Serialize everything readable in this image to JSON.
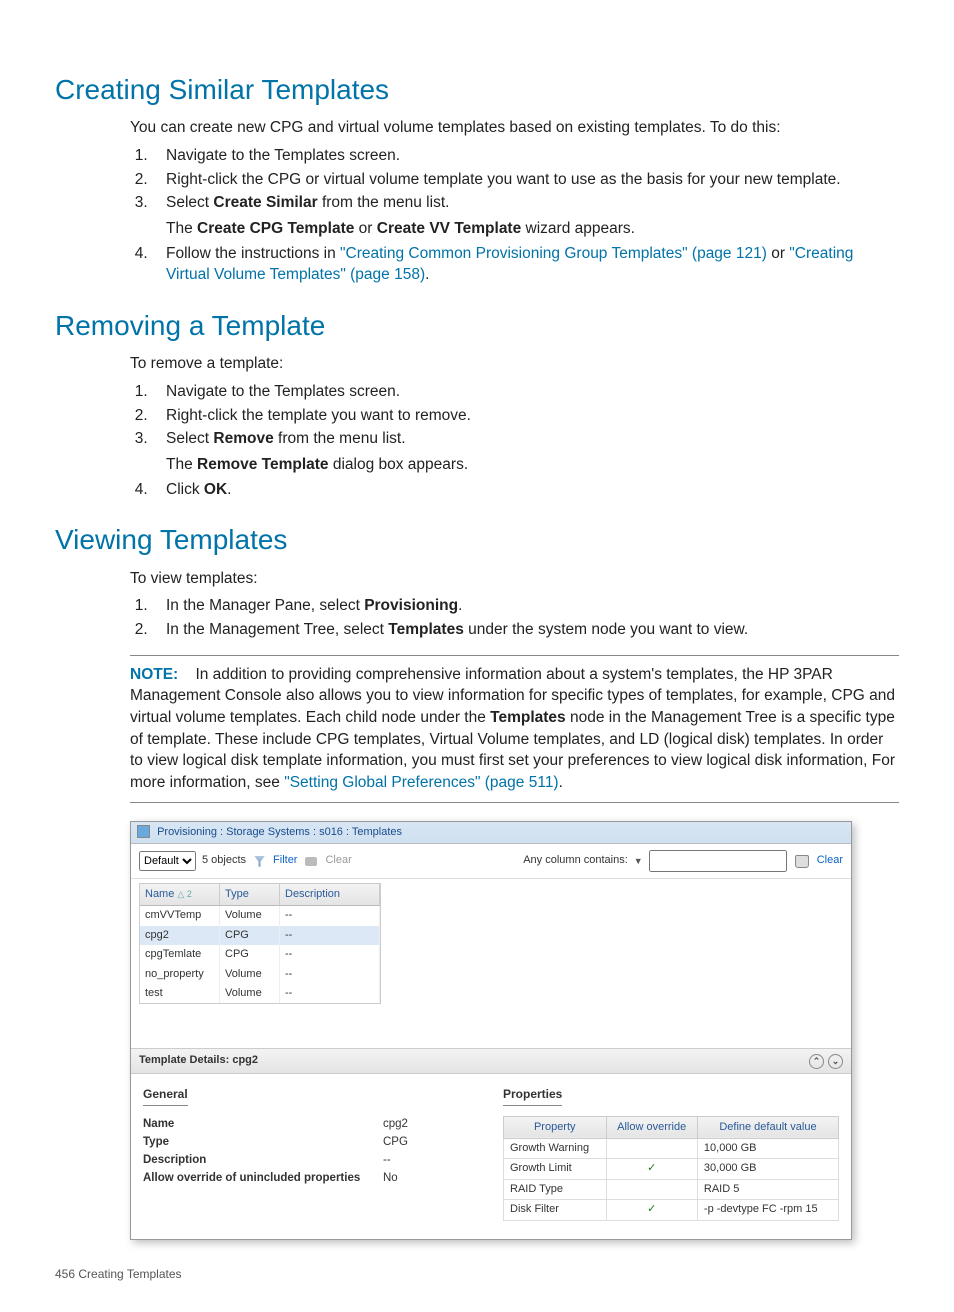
{
  "h1": "Creating Similar Templates",
  "p1": "You can create new CPG and virtual volume templates based on existing templates. To do this:",
  "l1_1": "Navigate to the Templates screen.",
  "l1_2": "Right-click the CPG or virtual volume template you want to use as the basis for your new template.",
  "l1_3a": "Select ",
  "l1_3b": "Create Similar",
  "l1_3c": " from the menu list.",
  "l1_3s1a": "The ",
  "l1_3s1b": "Create CPG Template",
  "l1_3s1c": " or ",
  "l1_3s1d": "Create VV Template",
  "l1_3s1e": " wizard appears.",
  "l1_4a": "Follow the instructions in ",
  "l1_4b": "\"Creating Common Provisioning Group Templates\" (page 121)",
  "l1_4c": " or ",
  "l1_4d": "\"Creating Virtual Volume Templates\" (page 158)",
  "l1_4e": ".",
  "h2": "Removing a Template",
  "p2": "To remove a template:",
  "l2_1": "Navigate to the Templates screen.",
  "l2_2": "Right-click the template you want to remove.",
  "l2_3a": "Select ",
  "l2_3b": "Remove",
  "l2_3c": " from the menu list.",
  "l2_3s1a": "The ",
  "l2_3s1b": "Remove Template",
  "l2_3s1c": " dialog box appears.",
  "l2_4a": "Click ",
  "l2_4b": "OK",
  "l2_4c": ".",
  "h3": "Viewing Templates",
  "p3": "To view templates:",
  "l3_1a": "In the Manager Pane, select ",
  "l3_1b": "Provisioning",
  "l3_1c": ".",
  "l3_2a": "In the Management Tree, select ",
  "l3_2b": "Templates",
  "l3_2c": " under the system node you want to view.",
  "noteLabel": "NOTE:",
  "noteA": "In addition to providing comprehensive information about a system's templates, the HP 3PAR Management Console also allows you to view information for specific types of templates, for example, CPG and virtual volume templates. Each child node under the ",
  "noteB": "Templates",
  "noteC": " node in the Management Tree is a specific type of template. These include CPG templates, Virtual Volume templates, and LD (logical disk) templates. In order to view logical disk template information, you must first set your preferences to view logical disk information, For more information, see ",
  "noteD": "\"Setting Global Preferences\" (page 511)",
  "noteE": ".",
  "ss": {
    "title": "Provisioning : Storage Systems : s016 : Templates",
    "default": "Default",
    "objcount": "5 objects",
    "filter": "Filter",
    "clear": "Clear",
    "anycol": "Any column contains:",
    "clear2": "Clear",
    "cols": {
      "name": "Name",
      "type": "Type",
      "desc": "Description",
      "sort": "△ 2"
    },
    "rows": [
      {
        "n": "cmVVTemp",
        "t": "Volume",
        "d": "--"
      },
      {
        "n": "cpg2",
        "t": "CPG",
        "d": "--"
      },
      {
        "n": "cpgTemlate",
        "t": "CPG",
        "d": "--"
      },
      {
        "n": "no_property",
        "t": "Volume",
        "d": "--"
      },
      {
        "n": "test",
        "t": "Volume",
        "d": "--"
      }
    ],
    "detailsTitle": "Template Details: cpg2",
    "general": "General",
    "g": {
      "nameK": "Name",
      "nameV": "cpg2",
      "typeK": "Type",
      "typeV": "CPG",
      "descK": "Description",
      "descV": "--",
      "allowK": "Allow override of unincluded properties",
      "allowV": "No"
    },
    "properties": "Properties",
    "ph": {
      "p": "Property",
      "a": "Allow override",
      "d": "Define default value"
    },
    "prows": [
      {
        "p": "Growth Warning",
        "a": "",
        "d": "10,000 GB"
      },
      {
        "p": "Growth Limit",
        "a": "✓",
        "d": "30,000 GB"
      },
      {
        "p": "RAID Type",
        "a": "",
        "d": "RAID 5"
      },
      {
        "p": "Disk Filter",
        "a": "✓",
        "d": "-p -devtype FC -rpm 15"
      }
    ]
  },
  "footer": "456   Creating Templates"
}
